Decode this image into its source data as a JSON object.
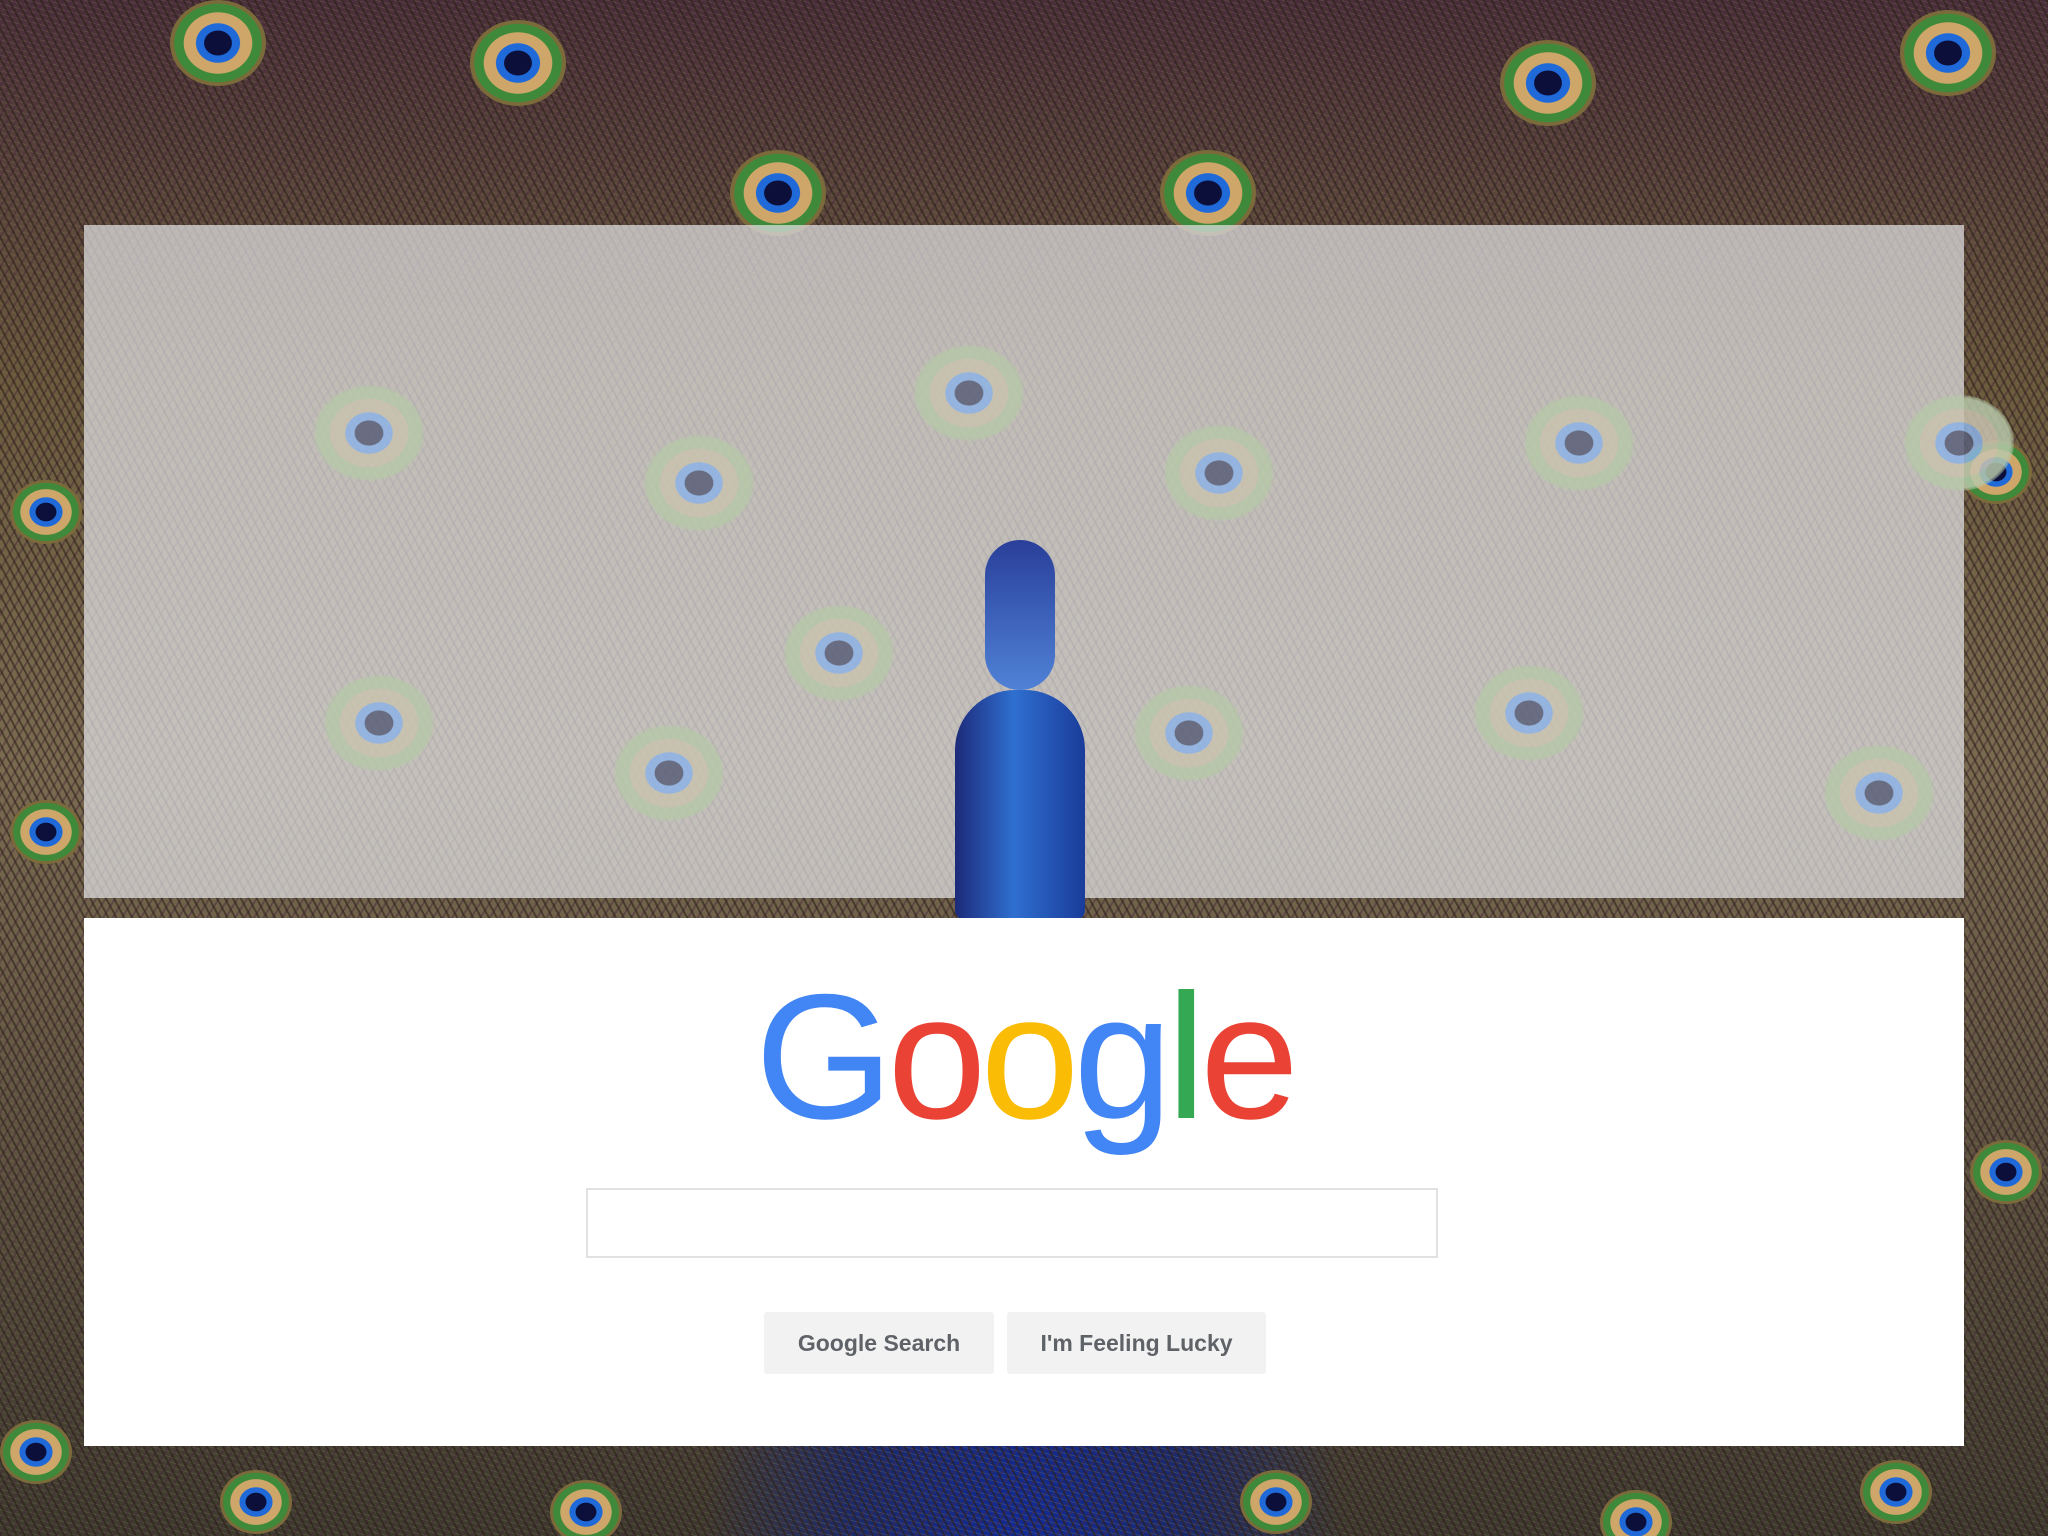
{
  "logo": {
    "letters": [
      "G",
      "o",
      "o",
      "g",
      "l",
      "e"
    ],
    "colors": [
      "#4285f4",
      "#ea4335",
      "#fbbc05",
      "#4285f4",
      "#34a853",
      "#ea4335"
    ]
  },
  "search": {
    "value": "",
    "placeholder": ""
  },
  "buttons": {
    "search_label": "Google Search",
    "lucky_label": "I'm Feeling Lucky"
  },
  "colors": {
    "button_bg": "#f2f2f2",
    "button_text": "#5f6368",
    "card_bg": "#ffffff",
    "input_border": "#e1e1e1"
  }
}
